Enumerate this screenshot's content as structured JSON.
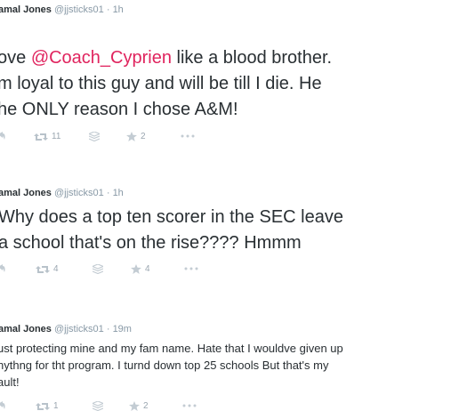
{
  "tweets": [
    {
      "name": "amal Jones",
      "handle": "@jjsticks01",
      "time": "· 1h",
      "lines": [
        {
          "pre": "ove ",
          "mention": "@Coach_Cyprien",
          "post": " like a blood brother."
        },
        {
          "pre": "m loyal to this guy and will be till I die. He",
          "mention": "",
          "post": ""
        },
        {
          "pre": "he ONLY reason I chose A&M!",
          "mention": "",
          "post": ""
        }
      ],
      "retweets": "11",
      "favorites": "2"
    },
    {
      "name": "amal Jones",
      "handle": "@jjsticks01",
      "time": "· 1h",
      "lines": [
        {
          "pre": "Why does a top ten scorer in the SEC leave",
          "mention": "",
          "post": ""
        },
        {
          "pre": "a school that's on the rise???? Hmmm",
          "mention": "",
          "post": ""
        }
      ],
      "retweets": "4",
      "favorites": "4"
    },
    {
      "name": "amal Jones",
      "handle": "@jjsticks01",
      "time": "· 19m",
      "lines": [
        {
          "pre": "ust protecting mine and my fam name. Hate that I wouldve given up",
          "mention": "",
          "post": ""
        },
        {
          "pre": "nythng for tht program. I turnd down top 25 schools But that's my",
          "mention": "",
          "post": ""
        },
        {
          "pre": "ault!",
          "mention": "",
          "post": ""
        }
      ],
      "retweets": "1",
      "favorites": "2"
    }
  ],
  "icons": {
    "reply": "reply-icon",
    "retweet": "retweet-icon",
    "buffer": "buffer-stack-icon",
    "favorite": "star-icon",
    "more": "more-dots-icon"
  },
  "colors": {
    "mention": "#e0245e",
    "meta": "#8899a6",
    "action": "#b1bbc3",
    "text": "#292f33"
  }
}
